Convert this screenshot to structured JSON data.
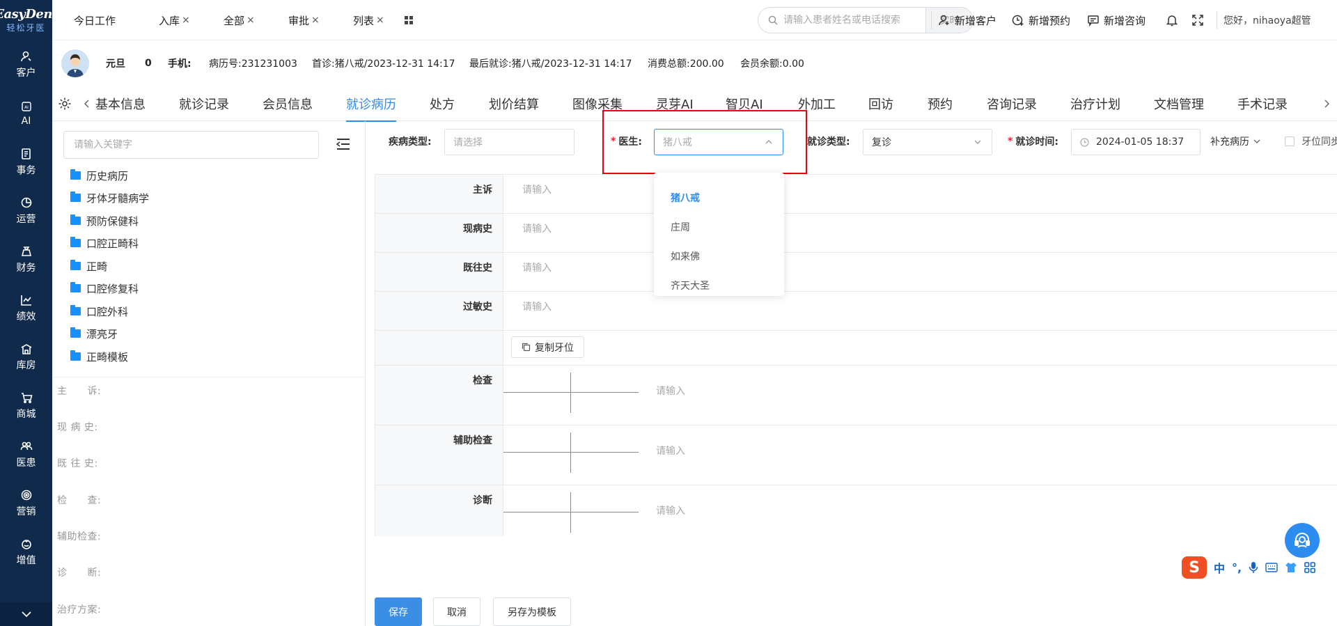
{
  "app": {
    "logo_text": "EasyDent",
    "logo_sub": "轻松牙医"
  },
  "sidenav": {
    "items": [
      {
        "label": "客户",
        "icon": "user-icon"
      },
      {
        "label": "AI",
        "icon": "ai-chip-icon"
      },
      {
        "label": "事务",
        "icon": "task-icon"
      },
      {
        "label": "运营",
        "icon": "pie-chart-icon"
      },
      {
        "label": "财务",
        "icon": "money-bag-icon"
      },
      {
        "label": "绩效",
        "icon": "line-chart-icon"
      },
      {
        "label": "库房",
        "icon": "warehouse-icon"
      },
      {
        "label": "商城",
        "icon": "cart-icon"
      },
      {
        "label": "医患",
        "icon": "people-icon"
      },
      {
        "label": "营销",
        "icon": "target-icon"
      },
      {
        "label": "增值",
        "icon": "gift-icon"
      }
    ]
  },
  "topbar": {
    "tabs": [
      {
        "label": "今日工作",
        "closable": false
      },
      {
        "label": "入库",
        "closable": true
      },
      {
        "label": "全部",
        "closable": true
      },
      {
        "label": "审批",
        "closable": true
      },
      {
        "label": "列表",
        "closable": true
      }
    ],
    "close_glyph": "×",
    "search": {
      "placeholder": "请输入患者姓名或电话搜索",
      "button": "实时"
    },
    "actions": {
      "new_customer": "新增客户",
      "new_appointment": "新增预约",
      "new_consult": "新增咨询"
    },
    "greeting": "您好，nihaoya超管"
  },
  "patient": {
    "name": "元旦",
    "age": "0",
    "phone_label": "手机:",
    "record_no": "病历号:231231003",
    "first_visit": "首诊:猪八戒/2023-12-31 14:17",
    "last_visit": "最后就诊:猪八戒/2023-12-31 14:17",
    "total_spend": "消费总额:200.00",
    "balance": "会员余额:0.00"
  },
  "subtabs": [
    "基本信息",
    "就诊记录",
    "会员信息",
    "就诊病历",
    "处方",
    "划价结算",
    "图像采集",
    "灵芽AI",
    "智贝AI",
    "外加工",
    "回访",
    "预约",
    "咨询记录",
    "治疗计划",
    "文档管理",
    "手术记录"
  ],
  "active_subtab": "就诊病历",
  "left_panel": {
    "search_placeholder": "请输入关键字",
    "tree": [
      "历史病历",
      "牙体牙髓病学",
      "预防保健科",
      "口腔正畸科",
      "正畸",
      "口腔修复科",
      "口腔外科",
      "漂亮牙",
      "正畸模板"
    ],
    "fields": [
      "主　　诉:",
      "现 病 史:",
      "既 往 史:",
      "检　　查:",
      "辅助检查:",
      "诊　　断:",
      "治疗方案:"
    ]
  },
  "form": {
    "disease_type_label": "疾病类型:",
    "disease_type_placeholder": "请选择",
    "doctor_label": "医生:",
    "doctor_value": "猪八戒",
    "visit_type_label": "就诊类型:",
    "visit_type_value": "复诊",
    "visit_time_label": "就诊时间:",
    "visit_time_value": "2024-01-05 18:37",
    "supplement": "补充病历",
    "tooth_sync": "牙位同步",
    "required_mark": "*"
  },
  "doctor_options": [
    "猪八戒",
    "庄周",
    "如来佛",
    "齐天大圣"
  ],
  "record": {
    "rows": [
      {
        "label": "主诉",
        "placeholder": "请输入"
      },
      {
        "label": "现病史",
        "placeholder": "请输入"
      },
      {
        "label": "既往史",
        "placeholder": "请输入"
      },
      {
        "label": "过敏史",
        "placeholder": "请输入"
      }
    ],
    "copy_tooth": "复制牙位",
    "tooth_rows": [
      {
        "label": "检查",
        "placeholder": "请输入"
      },
      {
        "label": "辅助检查",
        "placeholder": "请输入"
      },
      {
        "label": "诊断",
        "placeholder": "请输入"
      }
    ]
  },
  "buttons": {
    "save": "保存",
    "cancel": "取消",
    "save_template": "另存为模板"
  },
  "ime": {
    "logo": "S",
    "lang": "中",
    "punct": "°,"
  },
  "colors": {
    "nav_bg": "#102a4c",
    "accent": "#2d8cf0",
    "highlight_box": "#e60012"
  }
}
